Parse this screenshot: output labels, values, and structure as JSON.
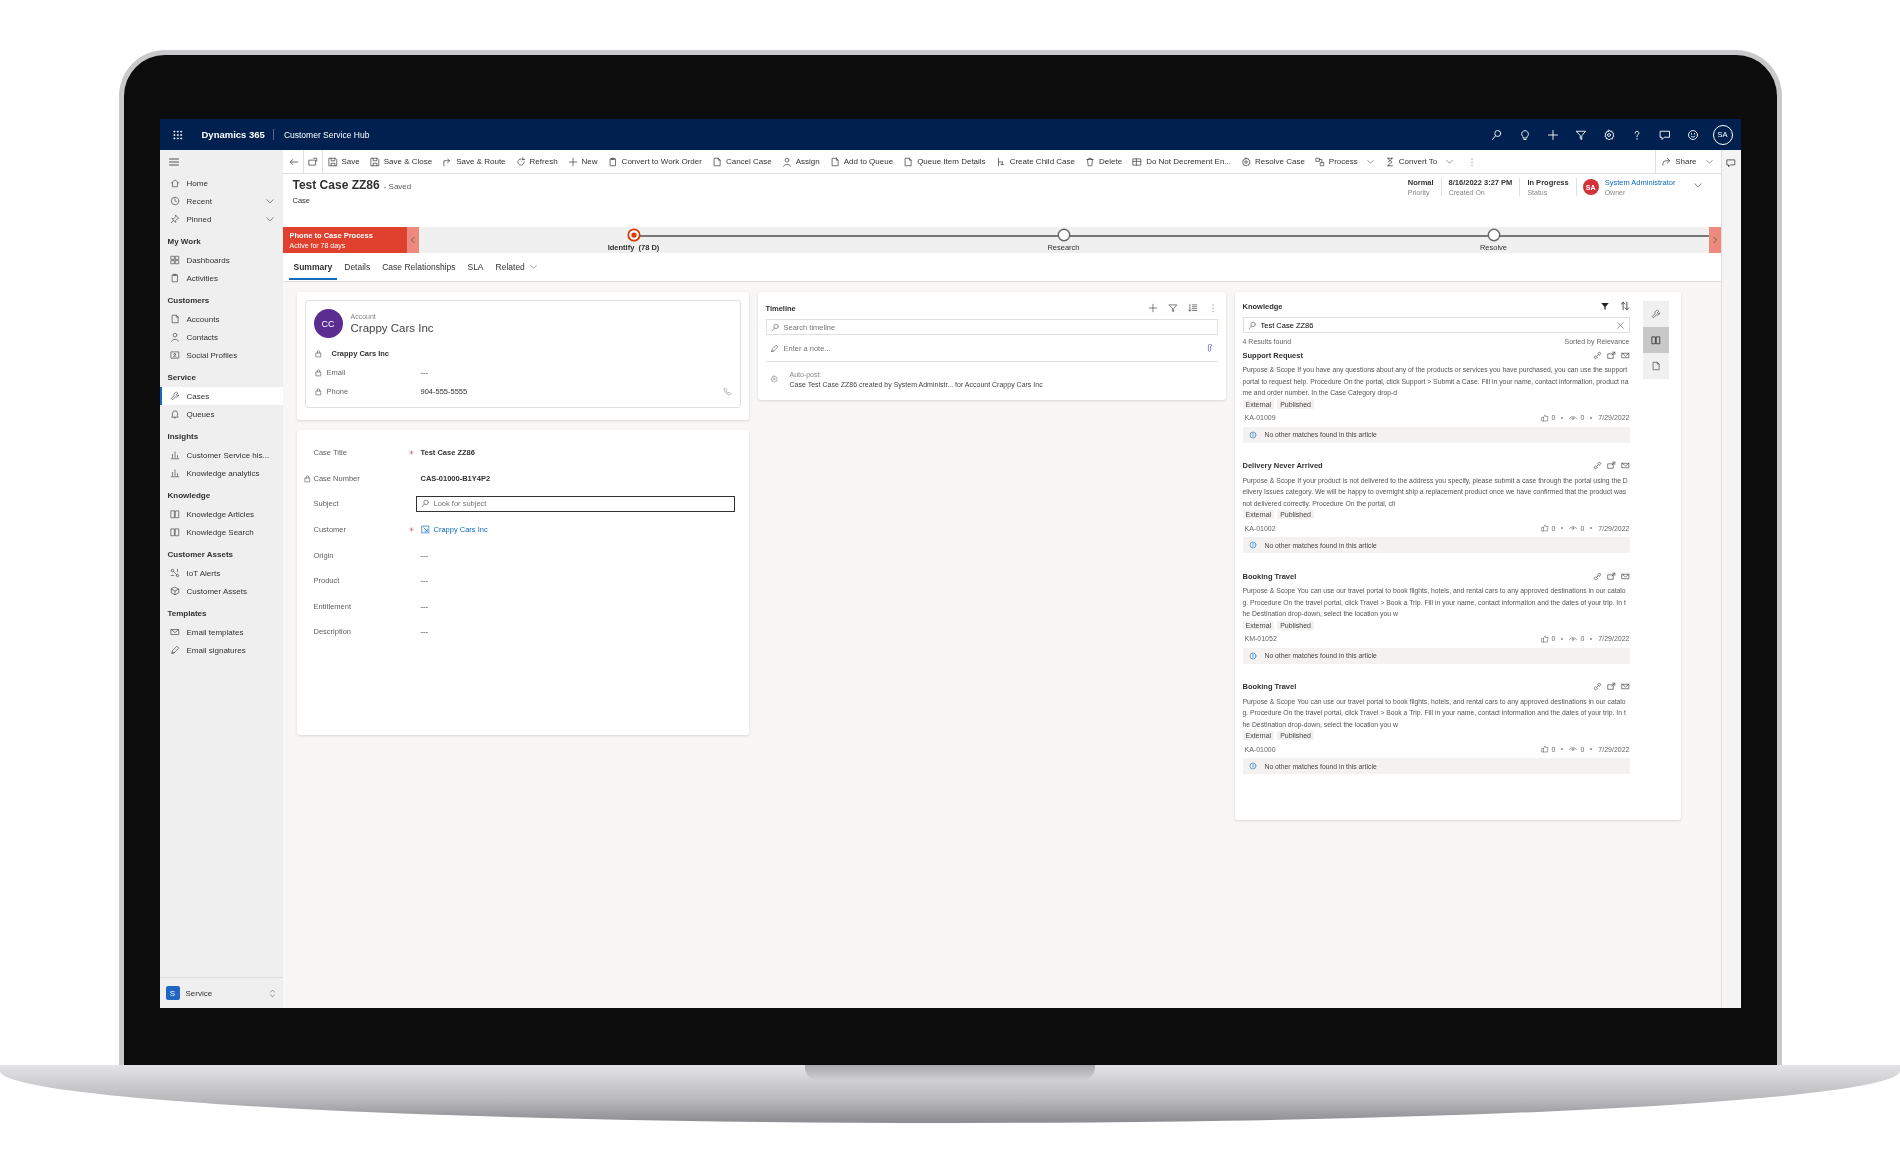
{
  "app": {
    "brand": "Dynamics 365",
    "app_name": "Customer Service Hub",
    "user_initials": "SA"
  },
  "sidebar": {
    "sections": [
      {
        "items": [
          {
            "label": "Home",
            "kind": "link",
            "selected": false
          },
          {
            "label": "Recent",
            "kind": "group",
            "selected": false
          },
          {
            "label": "Pinned",
            "kind": "group",
            "selected": false
          }
        ]
      },
      {
        "title": "My Work",
        "items": [
          {
            "label": "Dashboards",
            "kind": "link",
            "selected": false
          },
          {
            "label": "Activities",
            "kind": "link",
            "selected": false
          }
        ]
      },
      {
        "title": "Customers",
        "items": [
          {
            "label": "Accounts",
            "kind": "link",
            "selected": false
          },
          {
            "label": "Contacts",
            "kind": "link",
            "selected": false
          },
          {
            "label": "Social Profiles",
            "kind": "link",
            "selected": false
          }
        ]
      },
      {
        "title": "Service",
        "items": [
          {
            "label": "Cases",
            "kind": "link",
            "selected": true
          },
          {
            "label": "Queues",
            "kind": "link",
            "selected": false
          }
        ]
      },
      {
        "title": "Insights",
        "items": [
          {
            "label": "Customer Service his...",
            "kind": "link",
            "selected": false
          },
          {
            "label": "Knowledge analytics",
            "kind": "link",
            "selected": false
          }
        ]
      },
      {
        "title": "Knowledge",
        "items": [
          {
            "label": "Knowledge Articles",
            "kind": "link",
            "selected": false
          },
          {
            "label": "Knowledge Search",
            "kind": "link",
            "selected": false
          }
        ]
      },
      {
        "title": "Customer Assets",
        "items": [
          {
            "label": "IoT Alerts",
            "kind": "link",
            "selected": false
          },
          {
            "label": "Customer Assets",
            "kind": "link",
            "selected": false
          }
        ]
      },
      {
        "title": "Templates",
        "items": [
          {
            "label": "Email templates",
            "kind": "link",
            "selected": false
          },
          {
            "label": "Email signatures",
            "kind": "link",
            "selected": false
          }
        ]
      }
    ],
    "area": {
      "initial": "S",
      "label": "Service"
    }
  },
  "commands": [
    {
      "label": "Save",
      "menu": false
    },
    {
      "label": "Save & Close",
      "menu": false
    },
    {
      "label": "Save & Route",
      "menu": false
    },
    {
      "label": "Refresh",
      "menu": false
    },
    {
      "label": "New",
      "menu": false
    },
    {
      "label": "Convert to Work Order",
      "menu": false
    },
    {
      "label": "Cancel Case",
      "menu": false
    },
    {
      "label": "Assign",
      "menu": false
    },
    {
      "label": "Add to Queue",
      "menu": false
    },
    {
      "label": "Queue Item Details",
      "menu": false
    },
    {
      "label": "Create Child Case",
      "menu": false
    },
    {
      "label": "Delete",
      "menu": false
    },
    {
      "label": "Do Not Decrement En...",
      "menu": false
    },
    {
      "label": "Resolve Case",
      "menu": false
    },
    {
      "label": "Process",
      "menu": true
    },
    {
      "label": "Convert To",
      "menu": true
    }
  ],
  "share_command": {
    "label": "Share",
    "menu": true
  },
  "header": {
    "title": "Test Case ZZ86",
    "save_status": "- Saved",
    "entity": "Case",
    "fields": [
      {
        "value": "Normal",
        "label": "Priority"
      },
      {
        "value": "8/16/2022 3:27 PM",
        "label": "Created On"
      },
      {
        "value": "In Progress",
        "label": "Status"
      }
    ],
    "owner": {
      "initials": "SA",
      "name": "System Administrator",
      "label": "Owner"
    }
  },
  "process": {
    "name": "Phone to Case Process",
    "duration": "Active for 78 days",
    "stages": [
      {
        "label": "Identify",
        "duration": "(78 D)",
        "selected": true
      },
      {
        "label": "Research",
        "selected": false
      },
      {
        "label": "Resolve",
        "selected": false
      }
    ]
  },
  "tabs": [
    {
      "label": "Summary",
      "selected": true,
      "menu": false
    },
    {
      "label": "Details",
      "selected": false,
      "menu": false
    },
    {
      "label": "Case Relationships",
      "selected": false,
      "menu": false
    },
    {
      "label": "SLA",
      "selected": false,
      "menu": false
    },
    {
      "label": "Related",
      "selected": false,
      "menu": true
    }
  ],
  "account_card": {
    "label": "Account",
    "initials": "CC",
    "name": "Crappy Cars Inc",
    "fields": [
      {
        "kind": "parent",
        "value": "Crappy Cars Inc",
        "locked": true
      },
      {
        "kind": "text",
        "label": "Email",
        "value": "---",
        "locked": true
      },
      {
        "kind": "phone",
        "label": "Phone",
        "value": "904-555-5555",
        "locked": true
      }
    ]
  },
  "form": {
    "fields": [
      {
        "kind": "text",
        "label": "Case Title",
        "value": "Test Case ZZ86",
        "required": true,
        "locked": false
      },
      {
        "kind": "text",
        "label": "Case Number",
        "value": "CAS-01000-B1Y4P2",
        "required": false,
        "locked": true
      },
      {
        "kind": "lookup",
        "label": "Subject",
        "placeholder": "Look for subject",
        "required": false,
        "locked": false
      },
      {
        "kind": "link",
        "label": "Customer",
        "value": "Crappy Cars Inc",
        "required": true,
        "locked": false
      },
      {
        "kind": "empty",
        "label": "Origin",
        "value": "---",
        "required": false,
        "locked": false
      },
      {
        "kind": "empty",
        "label": "Product",
        "value": "---",
        "required": false,
        "locked": false
      },
      {
        "kind": "empty",
        "label": "Entitlement",
        "value": "---",
        "required": false,
        "locked": false
      },
      {
        "kind": "empty",
        "label": "Description",
        "value": "---",
        "required": false,
        "locked": false
      }
    ]
  },
  "timeline": {
    "title": "Timeline",
    "search_placeholder": "Search timeline",
    "note_placeholder": "Enter a note...",
    "posts": [
      {
        "title": "Auto-post:",
        "text": "Case Test Case ZZ86 created by System Administr... for Account Crappy Cars Inc"
      }
    ]
  },
  "knowledge": {
    "title": "Knowledge",
    "search_value": "Test Case ZZ86",
    "result_count": "4 Results found",
    "sort": "Sorted by Relevance",
    "articles": [
      {
        "title": "Support Request",
        "summary": "Purpose & Scope If you have any questions about any of the products or services you have purchased, you can use the support portal to request help. Procedure On the portal, click Support > Submit a Case. Fill in your name, contact information, product name and order number. In the Case Category drop-d",
        "tags": [
          "External",
          "Published"
        ],
        "number": "KA-01009",
        "likes": "0",
        "views": "0",
        "date": "7/29/2022",
        "note": "No other matches found in this article"
      },
      {
        "title": "Delivery Never Arrived",
        "summary": "Purpose & Scope If your product is not delivered to the address you specify, please submit a case through the portal using the Delivery Issues category. We will be happy to overnight ship a replacement product once we have confirmed that the product was not delivered correctly. Procedure On the portal, cli",
        "tags": [
          "External",
          "Published"
        ],
        "number": "KA-01002",
        "likes": "0",
        "views": "0",
        "date": "7/29/2022",
        "note": "No other matches found in this article"
      },
      {
        "title": "Booking Travel",
        "summary": "Purpose & Scope You can use our travel portal to book flights, hotels, and rental cars to any approved destinations in our catalog. Procedure On the travel portal, click Travel > Book a Trip. Fill in your name, contact information and the dates of your trip. In the Destination drop-down, select the location you w",
        "tags": [
          "External",
          "Published"
        ],
        "number": "KM-01052",
        "likes": "0",
        "views": "0",
        "date": "7/29/2022",
        "note": "No other matches found in this article"
      },
      {
        "title": "Booking Travel",
        "summary": "Purpose & Scope You can use our travel portal to book flights, hotels, and rental cars to any approved destinations in our catalog. Procedure On the travel portal, click Travel > Book a Trip. Fill in your name, contact information and the dates of your trip. In the Destination drop-down, select the location you w",
        "tags": [
          "External",
          "Published"
        ],
        "number": "KA-01000",
        "likes": "0",
        "views": "0",
        "date": "7/29/2022",
        "note": "No other matches found in this article"
      }
    ]
  },
  "side_tabs": [
    {
      "selected": false
    },
    {
      "selected": true
    },
    {
      "selected": false
    }
  ]
}
